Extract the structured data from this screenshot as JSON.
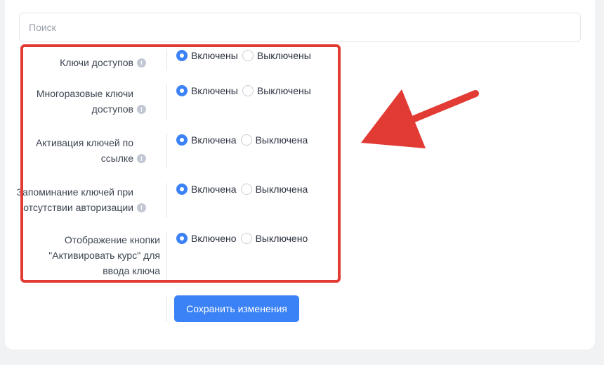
{
  "search": {
    "placeholder": "Поиск"
  },
  "settings": [
    {
      "label_lines": [
        "Ключи доступов"
      ],
      "options": [
        "Включены",
        "Выключены"
      ],
      "selected": 0
    },
    {
      "label_lines": [
        "Многоразовые ключи",
        "доступов"
      ],
      "options": [
        "Включены",
        "Выключены"
      ],
      "selected": 0
    },
    {
      "label_lines": [
        "Активация ключей по",
        "ссылке"
      ],
      "options": [
        "Включена",
        "Выключена"
      ],
      "selected": 0
    },
    {
      "label_lines": [
        "Запоминание ключей при",
        "отсутствии авторизации"
      ],
      "options": [
        "Включена",
        "Выключена"
      ],
      "selected": 0
    },
    {
      "label_lines": [
        "Отображение кнопки",
        "\"Активировать курс\" для",
        "ввода ключа"
      ],
      "options": [
        "Включено",
        "Выключено"
      ],
      "selected": 0
    }
  ],
  "info_icon": "info-icon",
  "save_label": "Сохранить изменения",
  "colors": {
    "accent": "#3b82f6",
    "highlight": "#e23b34"
  }
}
